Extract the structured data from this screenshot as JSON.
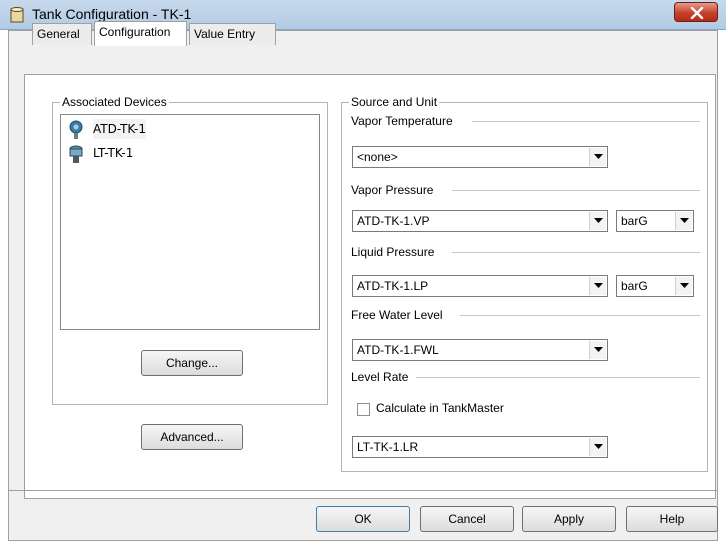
{
  "window": {
    "title": "Tank Configuration - TK-1",
    "close_label": "X"
  },
  "tabs": [
    {
      "label": "General"
    },
    {
      "label": "Configuration"
    },
    {
      "label": "Value Entry"
    }
  ],
  "associated_devices": {
    "label": "Associated Devices",
    "items": [
      {
        "label": "ATD-TK-1",
        "icon": "pressure-device-icon",
        "selected": true
      },
      {
        "label": "LT-TK-1",
        "icon": "level-transmitter-icon",
        "selected": false
      }
    ],
    "change_button": "Change...",
    "advanced_button": "Advanced..."
  },
  "source_and_unit": {
    "label": "Source and Unit",
    "vapor_temperature": {
      "label": "Vapor Temperature",
      "value": "<none>"
    },
    "vapor_pressure": {
      "label": "Vapor Pressure",
      "value": "ATD-TK-1.VP",
      "unit": "barG"
    },
    "liquid_pressure": {
      "label": "Liquid Pressure",
      "value": "ATD-TK-1.LP",
      "unit": "barG"
    },
    "free_water_level": {
      "label": "Free Water Level",
      "value": "ATD-TK-1.FWL"
    },
    "level_rate": {
      "label": "Level Rate",
      "checkbox_label": "Calculate in TankMaster",
      "checked": false,
      "value": "LT-TK-1.LR"
    }
  },
  "footer": {
    "ok": "OK",
    "cancel": "Cancel",
    "apply": "Apply",
    "help": "Help"
  },
  "colors": {
    "titlebar": "#b9d1ea",
    "close_button": "#c4402a",
    "dialog_bg": "#f0f0f0"
  }
}
